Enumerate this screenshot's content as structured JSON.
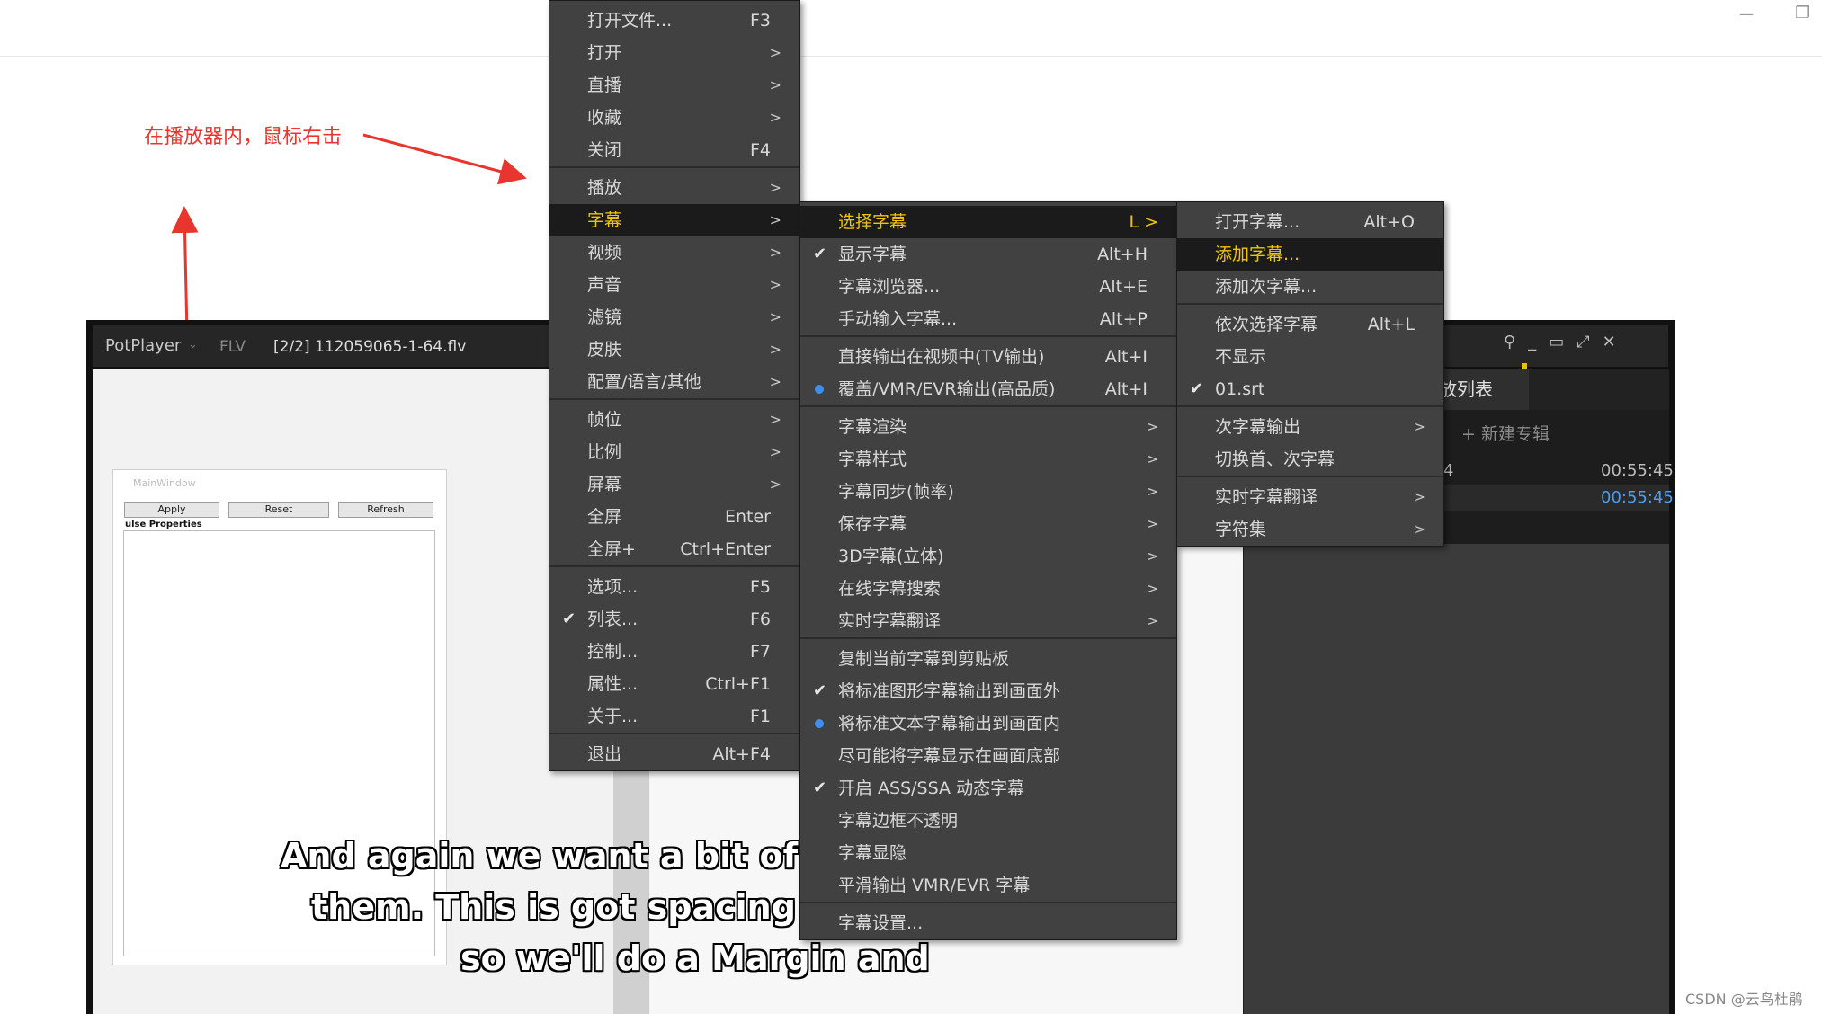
{
  "annotation": {
    "text": "在播放器内，鼠标右击"
  },
  "player": {
    "app_name": "PotPlayer",
    "format": "FLV",
    "file": "[2/2] 112059065-1-64.flv"
  },
  "designer": {
    "title": "MainWindow",
    "buttons": [
      "Apply",
      "Reset",
      "Refresh"
    ],
    "panel_label": "ulse Properties"
  },
  "playlist": {
    "tab": "放列表",
    "new_album": "+ 新建专辑",
    "rows": [
      {
        "name": "4",
        "time": "00:55:45"
      },
      {
        "name": "",
        "time": "00:55:45"
      }
    ]
  },
  "subtitle_lines": [
    "And again we want a bit of a sp",
    "them. This is got spacing abo",
    "so we'll do a Margin and"
  ],
  "main_menu": [
    {
      "label": "打开文件...",
      "key": "F3"
    },
    {
      "label": "打开",
      "arrow": ">"
    },
    {
      "label": "直播",
      "arrow": ">"
    },
    {
      "label": "收藏",
      "arrow": ">"
    },
    {
      "label": "关闭",
      "key": "F4"
    },
    {
      "label": "播放",
      "arrow": ">"
    },
    {
      "label": "字幕",
      "arrow": ">",
      "highlight": true
    },
    {
      "label": "视频",
      "arrow": ">"
    },
    {
      "label": "声音",
      "arrow": ">"
    },
    {
      "label": "滤镜",
      "arrow": ">"
    },
    {
      "label": "皮肤",
      "arrow": ">"
    },
    {
      "label": "配置/语言/其他",
      "arrow": ">"
    },
    {
      "label": "帧位",
      "arrow": ">"
    },
    {
      "label": "比例",
      "arrow": ">"
    },
    {
      "label": "屏幕",
      "arrow": ">"
    },
    {
      "label": "全屏",
      "key": "Enter"
    },
    {
      "label": "全屏+",
      "key": "Ctrl+Enter"
    },
    {
      "label": "选项...",
      "key": "F5"
    },
    {
      "label": "列表...",
      "key": "F6",
      "checked": true
    },
    {
      "label": "控制...",
      "key": "F7"
    },
    {
      "label": "属性...",
      "key": "Ctrl+F1"
    },
    {
      "label": "关于...",
      "key": "F1"
    },
    {
      "label": "退出",
      "key": "Alt+F4"
    }
  ],
  "subtitle_menu": [
    {
      "label": "选择字幕",
      "key": "L >",
      "highlight": true
    },
    {
      "label": "显示字幕",
      "key": "Alt+H",
      "checked": true
    },
    {
      "label": "字幕浏览器...",
      "key": "Alt+E"
    },
    {
      "label": "手动输入字幕...",
      "key": "Alt+P"
    },
    {
      "label": "直接输出在视频中(TV输出)",
      "key": "Alt+I"
    },
    {
      "label": "覆盖/VMR/EVR输出(高品质)",
      "key": "Alt+I",
      "radio": true
    },
    {
      "label": "字幕渲染",
      "arrow": ">"
    },
    {
      "label": "字幕样式",
      "arrow": ">"
    },
    {
      "label": "字幕同步(帧率)",
      "arrow": ">"
    },
    {
      "label": "保存字幕",
      "arrow": ">"
    },
    {
      "label": "3D字幕(立体)",
      "arrow": ">"
    },
    {
      "label": "在线字幕搜索",
      "arrow": ">"
    },
    {
      "label": "实时字幕翻译",
      "arrow": ">"
    },
    {
      "label": "复制当前字幕到剪贴板"
    },
    {
      "label": "将标准图形字幕输出到画面外",
      "checked": true
    },
    {
      "label": "将标准文本字幕输出到画面内",
      "radio": true
    },
    {
      "label": "尽可能将字幕显示在画面底部"
    },
    {
      "label": "开启 ASS/SSA 动态字幕",
      "checked": true
    },
    {
      "label": "字幕边框不透明"
    },
    {
      "label": "字幕显隐"
    },
    {
      "label": "平滑输出 VMR/EVR 字幕"
    },
    {
      "label": "字幕设置..."
    }
  ],
  "select_menu": [
    {
      "label": "打开字幕...",
      "key": "Alt+O"
    },
    {
      "label": "添加字幕...",
      "highlight": true
    },
    {
      "label": "添加次字幕..."
    },
    {
      "label": "依次选择字幕",
      "key": "Alt+L"
    },
    {
      "label": "不显示"
    },
    {
      "label": "01.srt",
      "checked": true
    },
    {
      "label": "次字幕输出",
      "arrow": ">"
    },
    {
      "label": "切换首、次字幕"
    },
    {
      "label": "实时字幕翻译",
      "arrow": ">"
    },
    {
      "label": "字符集",
      "arrow": ">"
    }
  ],
  "watermark": "CSDN @云鸟杜鹃",
  "icons": {
    "window_minimize": "minimize-icon",
    "window_restore": "restore-icon",
    "check": "check-icon",
    "radio": "radio-dot-icon"
  }
}
